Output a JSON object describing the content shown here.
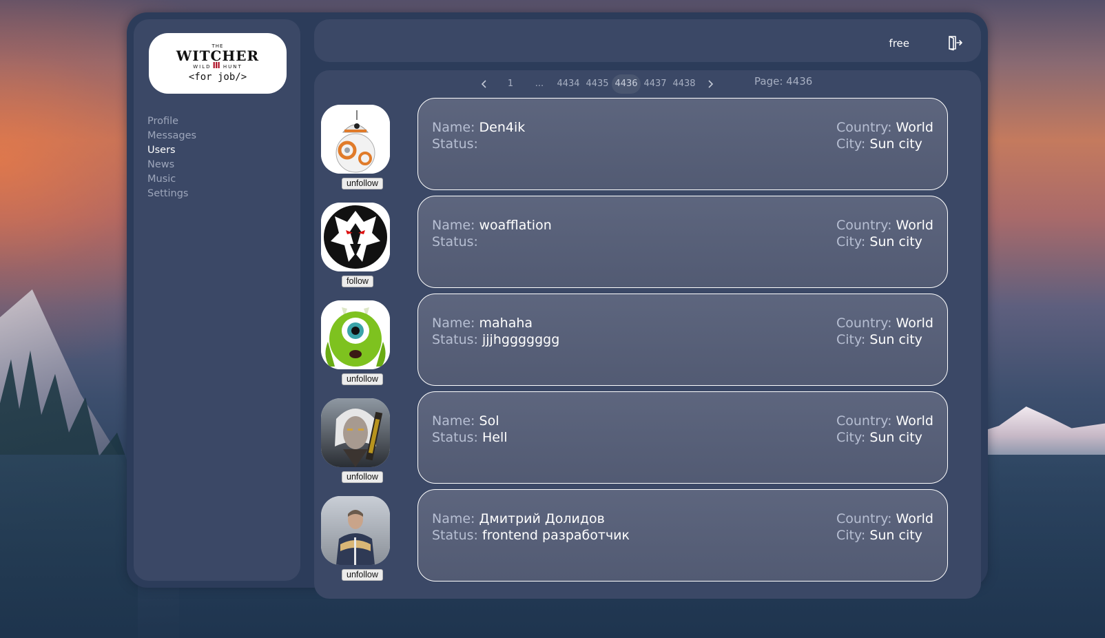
{
  "logo": {
    "line1": "THE",
    "line2": "WITCHER",
    "line3a": "WILD",
    "line3b": "HUNT",
    "tagline": "<for  job/>"
  },
  "nav": [
    {
      "label": "Profile",
      "active": false
    },
    {
      "label": "Messages",
      "active": false
    },
    {
      "label": "Users",
      "active": true
    },
    {
      "label": "News",
      "active": false
    },
    {
      "label": "Music",
      "active": false
    },
    {
      "label": "Settings",
      "active": false
    }
  ],
  "header": {
    "status": "free",
    "logout_icon": "logout-icon"
  },
  "pagination": {
    "prev_icon": "chevron-left-icon",
    "next_icon": "chevron-right-icon",
    "pages": [
      "1",
      "...",
      "4434",
      "4435",
      "4436",
      "4437",
      "4438"
    ],
    "current": "4436",
    "page_label": "Page: 4436"
  },
  "labels": {
    "name": "Name:",
    "status": "Status:",
    "country": "Country:",
    "city": "City:"
  },
  "users": [
    {
      "name": "Den4ik",
      "status": "",
      "country": "World",
      "city": "Sun city",
      "button": "unfollow",
      "avatar": "bb8-robot-avatar"
    },
    {
      "name": "woafflation",
      "status": "",
      "country": "World",
      "city": "Sun city",
      "button": "follow",
      "avatar": "wolf-medallion-avatar"
    },
    {
      "name": "mahaha",
      "status": "jjjhggggggg",
      "country": "World",
      "city": "Sun city",
      "button": "unfollow",
      "avatar": "green-one-eyed-monster-avatar"
    },
    {
      "name": "Sol",
      "status": "Hell",
      "country": "World",
      "city": "Sun city",
      "button": "unfollow",
      "avatar": "white-haired-warrior-avatar"
    },
    {
      "name": "Дмитрий Долидов",
      "status": "frontend разработчик",
      "country": "World",
      "city": "Sun city",
      "button": "unfollow",
      "avatar": "man-in-jacket-photo-avatar"
    }
  ]
}
